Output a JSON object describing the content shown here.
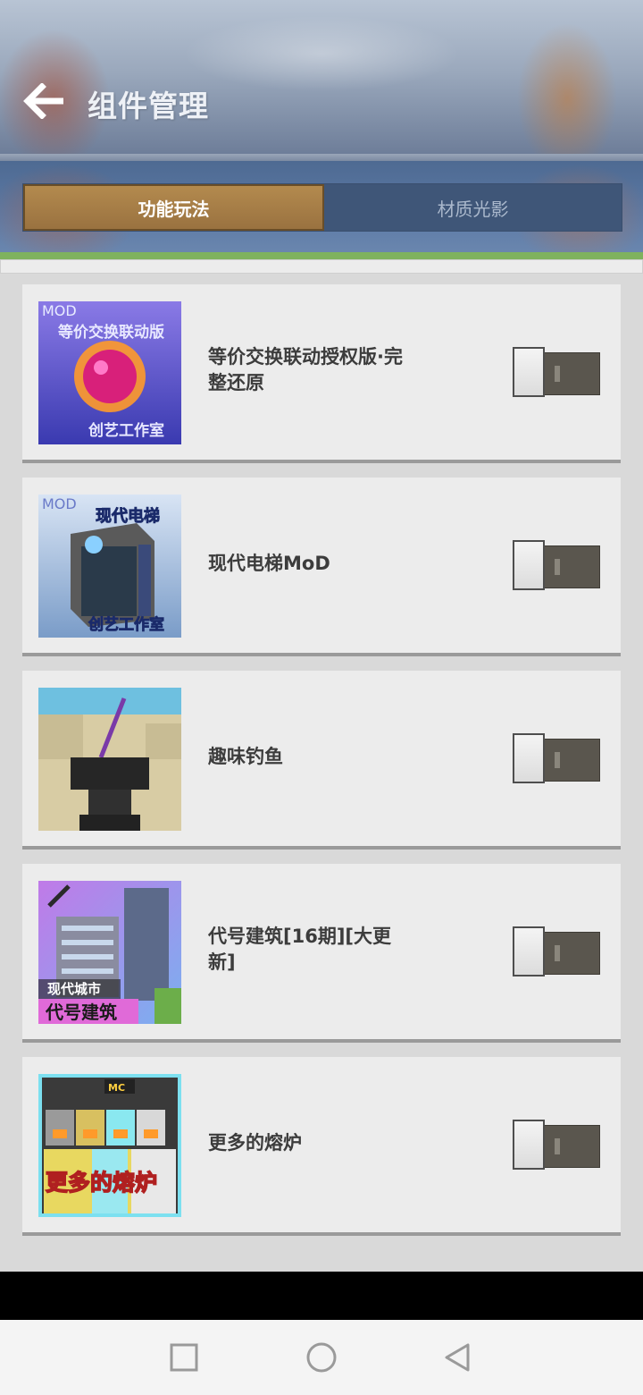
{
  "header": {
    "title": "组件管理",
    "back_icon": "arrow-left-icon"
  },
  "tabs": [
    {
      "label": "功能玩法",
      "active": true
    },
    {
      "label": "材质光影",
      "active": false
    }
  ],
  "items": [
    {
      "title": "等价交换联动授权版·完整还原",
      "enabled": false,
      "thumb_text": {
        "top": "MOD",
        "title": "等价交换联动版",
        "studio": "创艺工作室"
      }
    },
    {
      "title": "现代电梯MoD",
      "enabled": false,
      "thumb_text": {
        "top": "MOD",
        "title": "现代电梯",
        "studio": "创艺工作室"
      }
    },
    {
      "title": "趣味钓鱼",
      "enabled": false
    },
    {
      "title": "代号建筑[16期][大更新]",
      "enabled": false,
      "thumb_text": {
        "tag": "现代城市",
        "title": "代号建筑"
      }
    },
    {
      "title": "更多的熔炉",
      "enabled": false,
      "thumb_text": {
        "badge": "MC",
        "title": "更多的熔炉"
      }
    }
  ],
  "colors": {
    "active_tab": "#b38a4e",
    "toggle_off_track": "#5a564e",
    "accent_green": "#7fb25e"
  },
  "nav": {
    "recent_icon": "square-icon",
    "home_icon": "circle-icon",
    "back_icon": "triangle-back-icon"
  }
}
